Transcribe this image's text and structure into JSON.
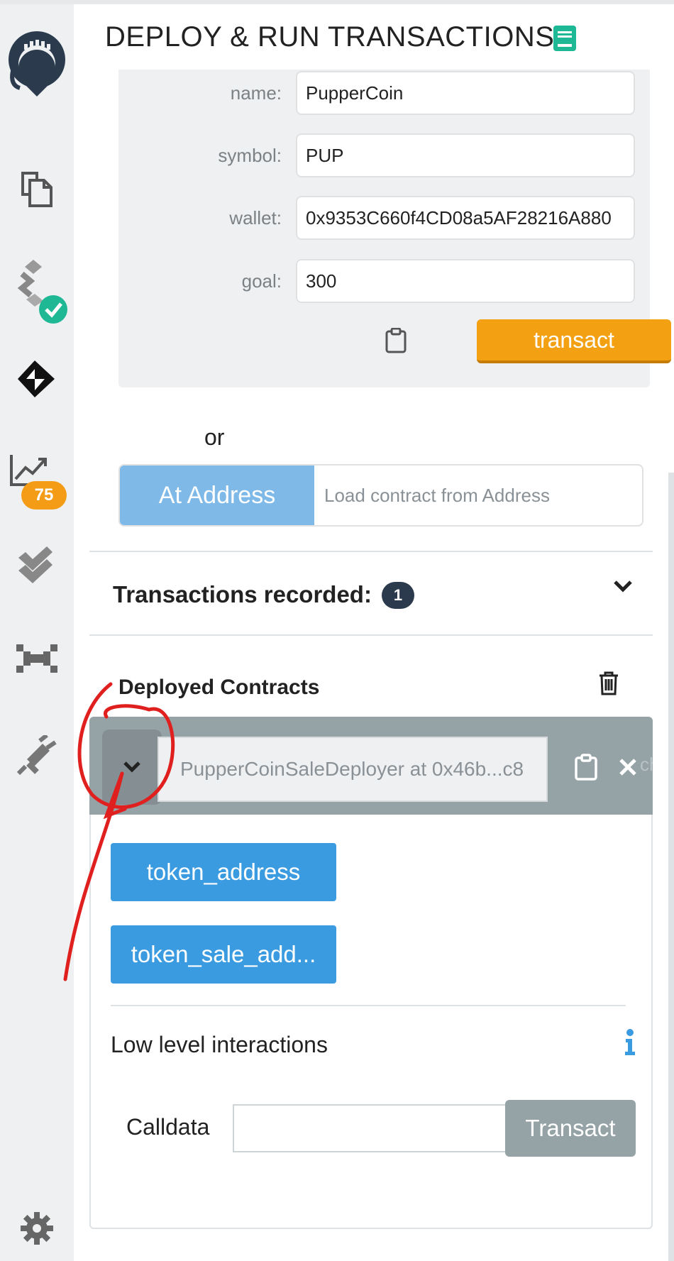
{
  "header": {
    "title": "DEPLOY & RUN TRANSACTIONS"
  },
  "sidebar": {
    "analysis_badge": "75"
  },
  "constructor": {
    "fields": [
      {
        "label": "name:",
        "value": "PupperCoin"
      },
      {
        "label": "symbol:",
        "value": "PUP"
      },
      {
        "label": "wallet:",
        "value": "0x9353C660f4CD08a5AF28216A880"
      },
      {
        "label": "goal:",
        "value": "300"
      }
    ],
    "transact_label": "transact"
  },
  "or_text": "or",
  "at_address": {
    "button_label": "At Address",
    "placeholder": "Load contract from Address"
  },
  "transactions": {
    "title": "Transactions recorded:",
    "count": "1"
  },
  "deployed": {
    "title": "Deployed Contracts",
    "instance": {
      "name": "PupperCoinSaleDeployer at 0x46b...c8",
      "overflow_text": "cha"
    },
    "functions": [
      "token_address",
      "token_sale_add..."
    ],
    "low_level": {
      "title": "Low level interactions",
      "calldata_label": "Calldata",
      "transact_label": "Transact"
    }
  },
  "colors": {
    "transact": "#f3a012",
    "at_address": "#7fb9e8",
    "function_button": "#3a9be0",
    "annotation": "#e0201e"
  }
}
